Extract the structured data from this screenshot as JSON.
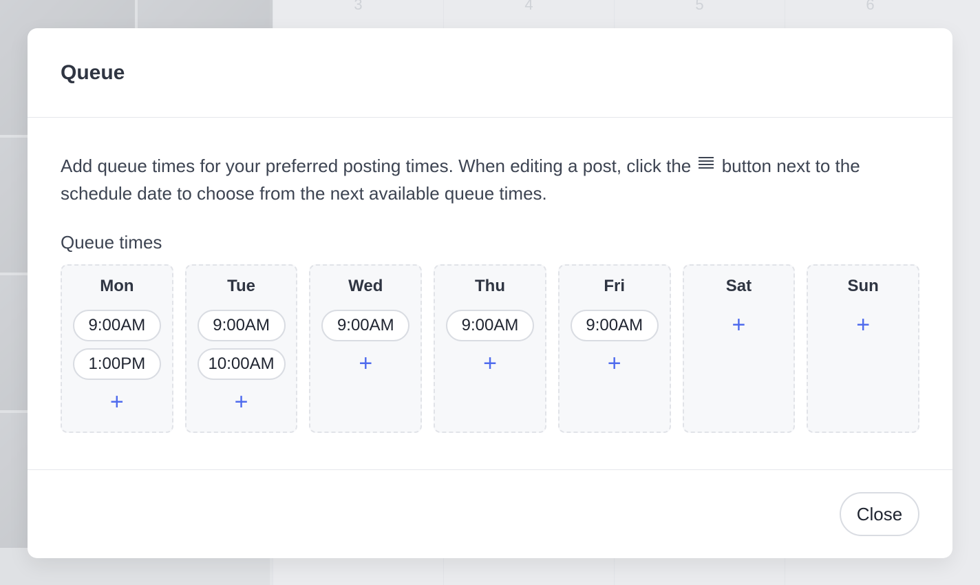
{
  "background": {
    "day_numbers": [
      "3",
      "4",
      "5",
      "6"
    ]
  },
  "modal": {
    "title": "Queue",
    "description_before_icon": "Add queue times for your preferred posting times. When editing a post, click the",
    "description_icon": "list-icon",
    "description_after_icon": "button next to the schedule date to choose from the next available queue times.",
    "section_label": "Queue times",
    "add_icon": "+",
    "days": [
      {
        "name": "Mon",
        "times": [
          "9:00AM",
          "1:00PM"
        ]
      },
      {
        "name": "Tue",
        "times": [
          "9:00AM",
          "10:00AM"
        ]
      },
      {
        "name": "Wed",
        "times": [
          "9:00AM"
        ]
      },
      {
        "name": "Thu",
        "times": [
          "9:00AM"
        ]
      },
      {
        "name": "Fri",
        "times": [
          "9:00AM"
        ]
      },
      {
        "name": "Sat",
        "times": []
      },
      {
        "name": "Sun",
        "times": []
      }
    ],
    "close_label": "Close"
  },
  "colors": {
    "accent": "#4f6bed",
    "title": "#2f3542",
    "text": "#3d4452"
  }
}
